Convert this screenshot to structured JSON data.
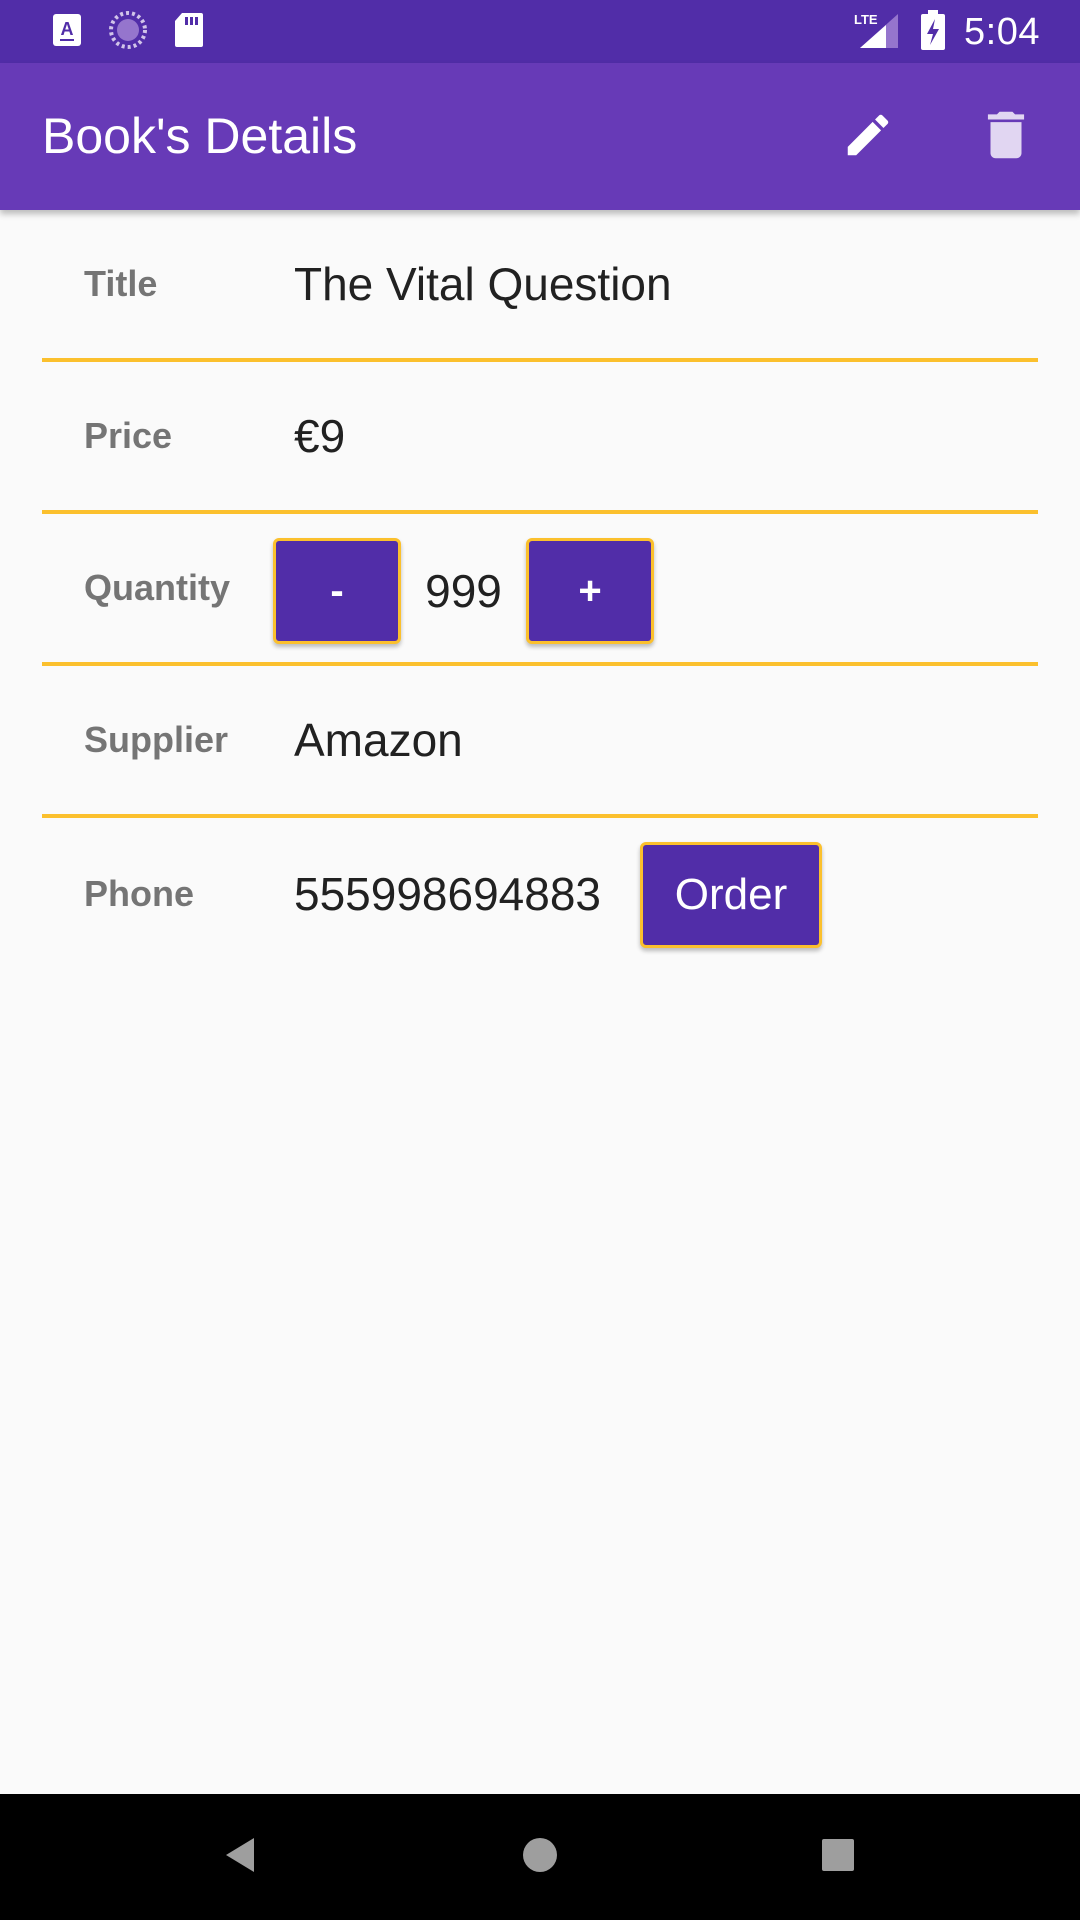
{
  "status_bar": {
    "time": "5:04",
    "network_label": "LTE"
  },
  "app_bar": {
    "title": "Book's Details",
    "edit_icon": "pencil-icon",
    "delete_icon": "trash-icon"
  },
  "form": {
    "title_label": "Title",
    "title_value": "The Vital Question",
    "price_label": "Price",
    "price_value": "€9",
    "quantity_label": "Quantity",
    "decrement_label": "-",
    "quantity_value": "999",
    "increment_label": "+",
    "supplier_label": "Supplier",
    "supplier_value": "Amazon",
    "phone_label": "Phone",
    "phone_value": "555998694883",
    "order_label": "Order"
  },
  "colors": {
    "status_bar": "#512DA8",
    "app_bar": "#673AB7",
    "accent": "#FBC02D",
    "button": "#512DA8"
  }
}
